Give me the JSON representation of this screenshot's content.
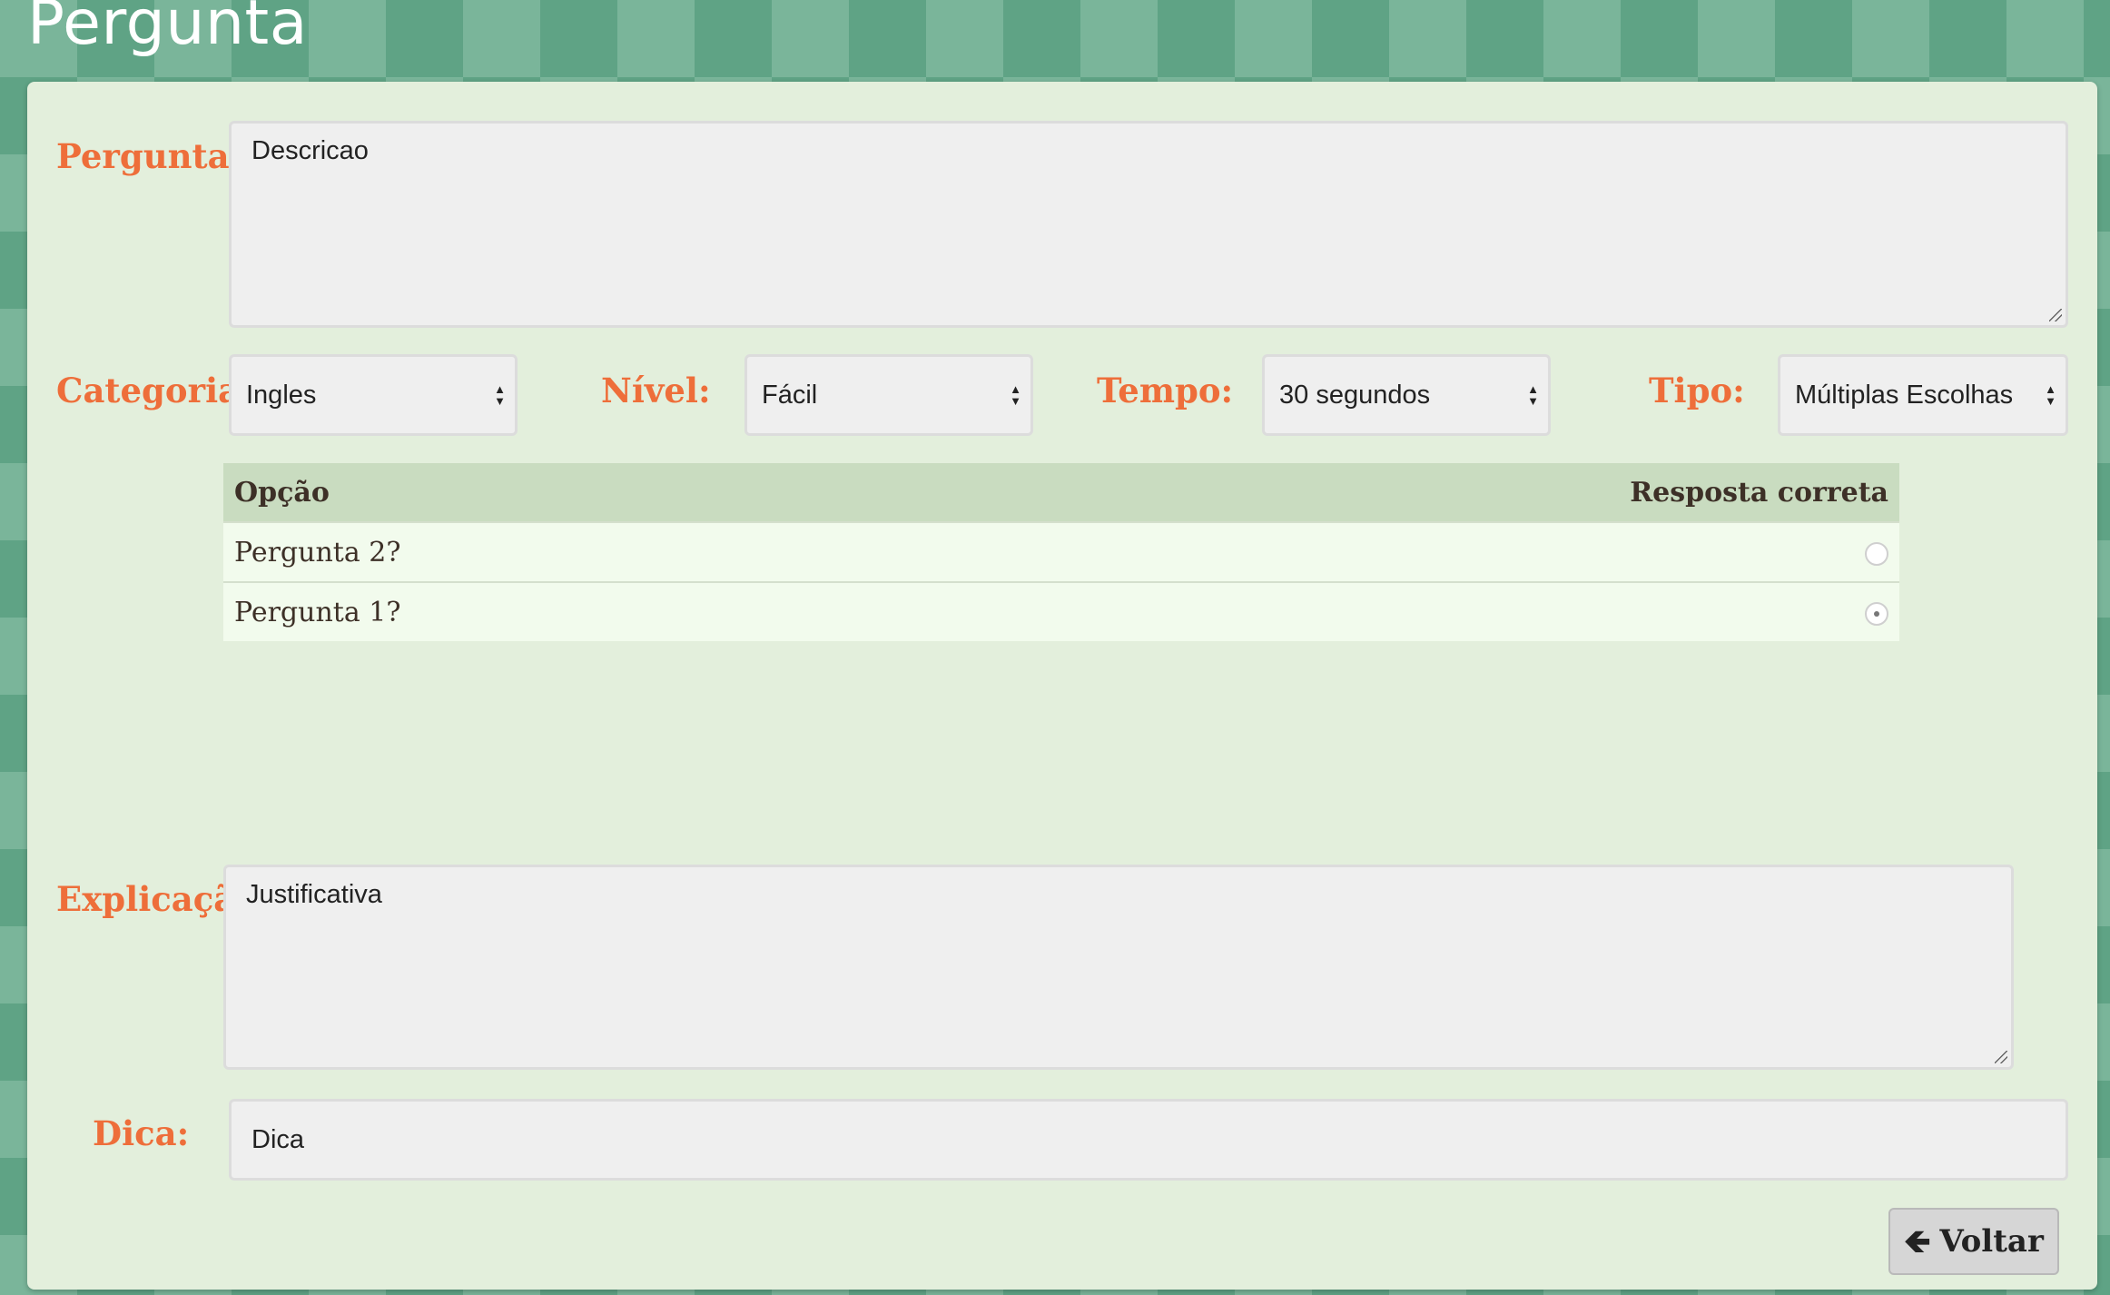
{
  "header": {
    "title": "Pergunta"
  },
  "form": {
    "pergunta": {
      "label": "Pergunta:",
      "value": "Descricao"
    },
    "categoria": {
      "label": "Categoria:",
      "selected": "Ingles"
    },
    "nivel": {
      "label": "Nível:",
      "selected": "Fácil"
    },
    "tempo": {
      "label": "Tempo:",
      "selected": "30 segundos"
    },
    "tipo": {
      "label": "Tipo:",
      "selected": "Múltiplas Escolhas"
    },
    "explicacao": {
      "label": "Explicação:",
      "value": "Justificativa"
    },
    "dica": {
      "label": "Dica:",
      "value": "Dica"
    }
  },
  "options_table": {
    "headers": {
      "option": "Opção",
      "correct": "Resposta correta"
    },
    "rows": [
      {
        "text": "Pergunta 2?",
        "correct": false
      },
      {
        "text": "Pergunta 1?",
        "correct": true
      }
    ]
  },
  "actions": {
    "back_label": "Voltar",
    "back_icon": "arrow-left-icon"
  },
  "colors": {
    "label": "#ee6e3a",
    "panel": "#e3efdc",
    "table_header": "#c9dcc0"
  }
}
